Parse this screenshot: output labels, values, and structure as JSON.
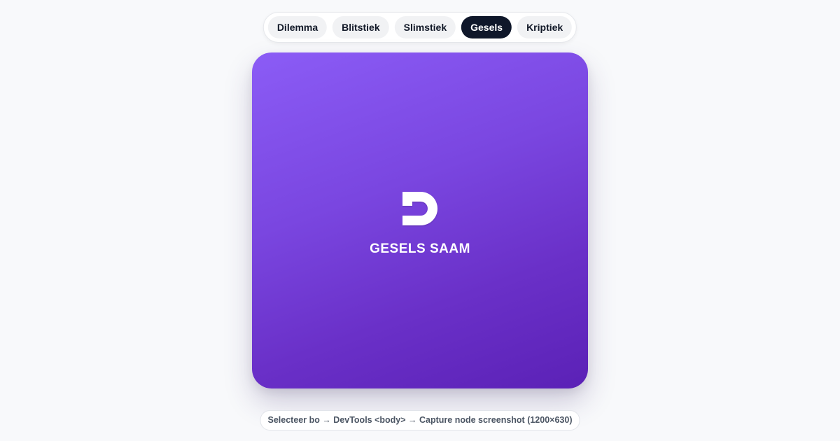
{
  "tabs": [
    {
      "label": "Dilemma",
      "active": false
    },
    {
      "label": "Blitstiek",
      "active": false
    },
    {
      "label": "Slimstiek",
      "active": false
    },
    {
      "label": "Gesels",
      "active": true
    },
    {
      "label": "Kriptiek",
      "active": false
    }
  ],
  "card": {
    "logo_icon": "gesels-logo-icon",
    "brand_text": "GESELS SAAM",
    "gradient_start": "#8b5cf6",
    "gradient_end": "#5b21b6"
  },
  "hint": {
    "text": "Selecteer bo → DevTools <body> → Capture node screenshot (1200×630)"
  },
  "colors": {
    "active_tab_bg": "#0f172a",
    "tab_bg": "#f1f2f4",
    "page_bg": "#f8f9fb"
  }
}
